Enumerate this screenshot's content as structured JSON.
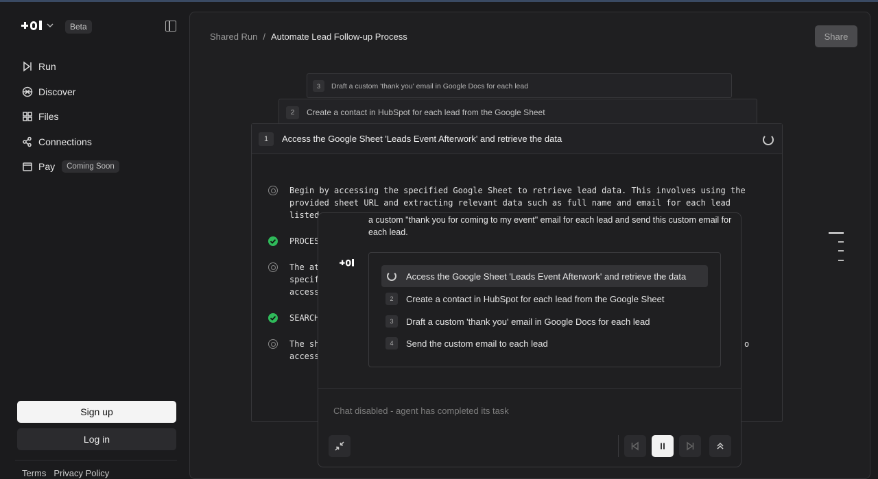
{
  "sidebar": {
    "beta_label": "Beta",
    "items": [
      {
        "label": "Run"
      },
      {
        "label": "Discover"
      },
      {
        "label": "Files"
      },
      {
        "label": "Connections"
      },
      {
        "label": "Pay",
        "badge": "Coming Soon"
      }
    ],
    "signup_label": "Sign up",
    "login_label": "Log in",
    "footer": {
      "terms": "Terms",
      "privacy": "Privacy Policy"
    }
  },
  "header": {
    "breadcrumb_parent": "Shared Run",
    "breadcrumb_sep": "/",
    "breadcrumb_current": "Automate Lead Follow-up Process",
    "share_label": "Share"
  },
  "steps_stack": [
    {
      "num": "3",
      "title": "Draft a custom 'thank you' email in Google Docs for each lead"
    },
    {
      "num": "2",
      "title": "Create a contact in HubSpot for each lead from the Google Sheet"
    },
    {
      "num": "1",
      "title": "Access the Google Sheet 'Leads Event Afterwork' and retrieve the data"
    }
  ],
  "log": [
    {
      "icon": "target-icon",
      "text": "Begin by accessing the specified Google Sheet to retrieve lead data. This involves using the\nprovided sheet URL and extracting relevant data such as full name and email for each lead\nlisted."
    },
    {
      "icon": "check-icon",
      "text": "PROCES"
    },
    {
      "icon": "target-icon",
      "text": "The at\nspecif\naccess"
    },
    {
      "icon": "check-icon",
      "text": "SEARCH"
    },
    {
      "icon": "target-icon",
      "text": "The sh\naccess",
      "tail": "o"
    }
  ],
  "overlay": {
    "task_text": "a custom \"thank you for coming to my event\" email for each lead and send this custom email for each lead.",
    "plan": [
      {
        "num": "",
        "status": "in-progress",
        "title": "Access the Google Sheet 'Leads Event Afterwork' and retrieve the data"
      },
      {
        "num": "2",
        "title": "Create a contact in HubSpot for each lead from the Google Sheet"
      },
      {
        "num": "3",
        "title": "Draft a custom 'thank you' email in Google Docs for each lead"
      },
      {
        "num": "4",
        "title": "Send the custom email to each lead"
      }
    ],
    "chat_placeholder": "Chat disabled - agent has completed its task"
  },
  "colors": {
    "accent_check": "#2fba5a",
    "background": "#1b1b1d"
  }
}
